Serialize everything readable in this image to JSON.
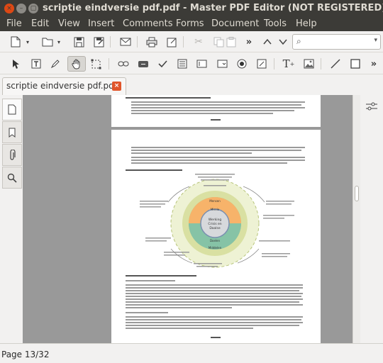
{
  "window": {
    "title": "scriptie eindversie pdf.pdf - Master PDF Editor (NOT REGISTERED)"
  },
  "menu": [
    "File",
    "Edit",
    "View",
    "Insert",
    "Comments",
    "Forms",
    "Document",
    "Tools",
    "Help"
  ],
  "toolbar1": {
    "icons": [
      "new-document-icon",
      "open-folder-icon",
      "save-icon",
      "save-as-icon",
      "email-icon",
      "print-icon",
      "export-icon",
      "cut-icon",
      "copy-icon",
      "paste-icon",
      "undo-icon",
      "redo-icon"
    ],
    "search": {
      "value": "",
      "placeholder": ""
    }
  },
  "toolbar2": {
    "icons": [
      "select-arrow-icon",
      "text-select-icon",
      "edit-text-icon",
      "hand-icon",
      "marquee-icon",
      "link-icon",
      "button-field-icon",
      "checkbox-icon",
      "list-field-icon",
      "radio-icon",
      "combo-icon",
      "add-text-icon",
      "add-image-icon",
      "line-icon",
      "rectangle-icon"
    ],
    "active_tool": "hand-icon"
  },
  "tabs": [
    {
      "label": "scriptie eindversie pdf.pdf",
      "close": "×"
    }
  ],
  "left_panel": [
    "page-thumbnails-icon",
    "bookmarks-icon",
    "attachments-icon",
    "search-panel-icon"
  ],
  "document": {
    "page_top_label": "pag. 8",
    "page_bottom_label": "pag. 9",
    "diagram": {
      "center": [
        "Werking",
        "Crisis en",
        "Daalse"
      ],
      "ring_labels": [
        "Mensen",
        "Missie",
        "Doelen",
        "Middelen"
      ]
    }
  },
  "status": {
    "page": "Page 13/32"
  }
}
